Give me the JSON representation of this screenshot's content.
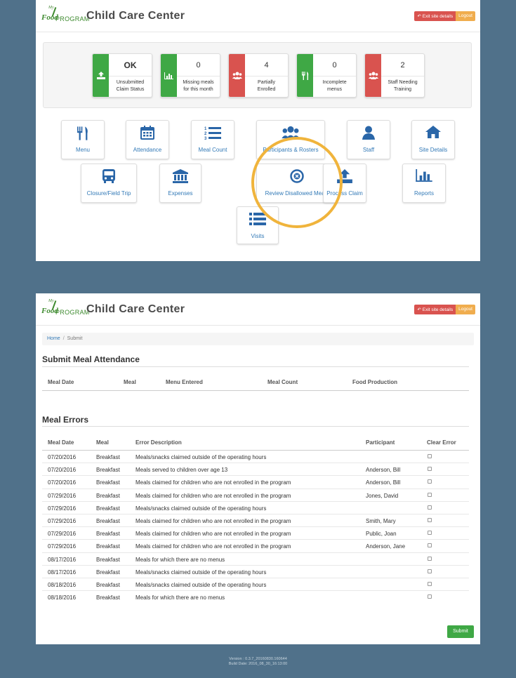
{
  "header": {
    "logo_my": "My",
    "logo_food": "Food",
    "logo_program": "PROGRAM",
    "title": "Child Care Center",
    "exit_label": "Exit site details",
    "logout_label": "Logout"
  },
  "status_cards": [
    {
      "value": "OK",
      "label_line1": "Unsubmitted",
      "label_line2": "Claim Status",
      "color": "#3fa845",
      "icon": "upload-icon"
    },
    {
      "value": "0",
      "label_line1": "Missing meals",
      "label_line2": "for this month",
      "color": "#3fa845",
      "icon": "bar-chart-icon"
    },
    {
      "value": "4",
      "label_line1": "Partially",
      "label_line2": "Enrolled",
      "color": "#d9534f",
      "icon": "users-icon"
    },
    {
      "value": "0",
      "label_line1": "Incomplete",
      "label_line2": "menus",
      "color": "#3fa845",
      "icon": "utensils-icon"
    },
    {
      "value": "2",
      "label_line1": "Staff Needing",
      "label_line2": "Training",
      "color": "#d9534f",
      "icon": "users-icon"
    }
  ],
  "nav_buttons": [
    {
      "label": "Menu",
      "icon": "utensils-icon"
    },
    {
      "label": "Attendance",
      "icon": "calendar-icon"
    },
    {
      "label": "Meal Count",
      "icon": "numbered-list-icon"
    },
    {
      "label": "Participants & Rosters",
      "icon": "users-icon"
    },
    {
      "label": "Staff",
      "icon": "user-icon"
    },
    {
      "label": "Site Details",
      "icon": "home-icon"
    },
    {
      "label": "Closure/Field Trip",
      "icon": "bus-icon"
    },
    {
      "label": "Expenses",
      "icon": "bank-icon"
    },
    {
      "label": "Review Disallowed Meals",
      "icon": "x-circle-icon"
    },
    {
      "label": "Process Claim",
      "icon": "upload-icon"
    },
    {
      "label": "Reports",
      "icon": "bar-chart-icon"
    },
    {
      "label": "Visits",
      "icon": "list-icon"
    }
  ],
  "breadcrumb": {
    "home": "Home",
    "separator": "/",
    "current": "Submit"
  },
  "submit_section": {
    "title": "Submit Meal Attendance",
    "columns": [
      "Meal Date",
      "Meal",
      "Menu Entered",
      "Meal Count",
      "Food Production"
    ]
  },
  "errors_section": {
    "title": "Meal Errors",
    "columns": [
      "Meal Date",
      "Meal",
      "Error Description",
      "Participant",
      "Clear Error"
    ],
    "rows": [
      {
        "date": "07/20/2016",
        "meal": "Breakfast",
        "desc": "Meals/snacks claimed outside of the operating hours",
        "participant": ""
      },
      {
        "date": "07/20/2016",
        "meal": "Breakfast",
        "desc": "Meals served to children over age 13",
        "participant": "Anderson, Bill"
      },
      {
        "date": "07/20/2016",
        "meal": "Breakfast",
        "desc": "Meals claimed for children who are not enrolled in the program",
        "participant": "Anderson, Bill"
      },
      {
        "date": "07/29/2016",
        "meal": "Breakfast",
        "desc": "Meals claimed for children who are not enrolled in the program",
        "participant": "Jones, David"
      },
      {
        "date": "07/29/2016",
        "meal": "Breakfast",
        "desc": "Meals/snacks claimed outside of the operating hours",
        "participant": ""
      },
      {
        "date": "07/29/2016",
        "meal": "Breakfast",
        "desc": "Meals claimed for children who are not enrolled in the program",
        "participant": "Smith, Mary"
      },
      {
        "date": "07/29/2016",
        "meal": "Breakfast",
        "desc": "Meals claimed for children who are not enrolled in the program",
        "participant": "Public, Joan"
      },
      {
        "date": "07/29/2016",
        "meal": "Breakfast",
        "desc": "Meals claimed for children who are not enrolled in the program",
        "participant": "Anderson, Jane"
      },
      {
        "date": "08/17/2016",
        "meal": "Breakfast",
        "desc": "Meals for which there are no menus",
        "participant": ""
      },
      {
        "date": "08/17/2016",
        "meal": "Breakfast",
        "desc": "Meals/snacks claimed outside of the operating hours",
        "participant": ""
      },
      {
        "date": "08/18/2016",
        "meal": "Breakfast",
        "desc": "Meals/snacks claimed outside of the operating hours",
        "participant": ""
      },
      {
        "date": "08/18/2016",
        "meal": "Breakfast",
        "desc": "Meals for which there are no menus",
        "participant": ""
      }
    ]
  },
  "submit_label": "Submit",
  "footer": {
    "version": "Version : 0.3.7_20160830.160644",
    "build": "Build Date: 2016_08_30_16:13:00"
  },
  "colors": {
    "accent_blue": "#337ab7",
    "green": "#3fa845",
    "red": "#d9534f",
    "orange": "#f0ad4e",
    "highlight": "#f0b43c"
  }
}
